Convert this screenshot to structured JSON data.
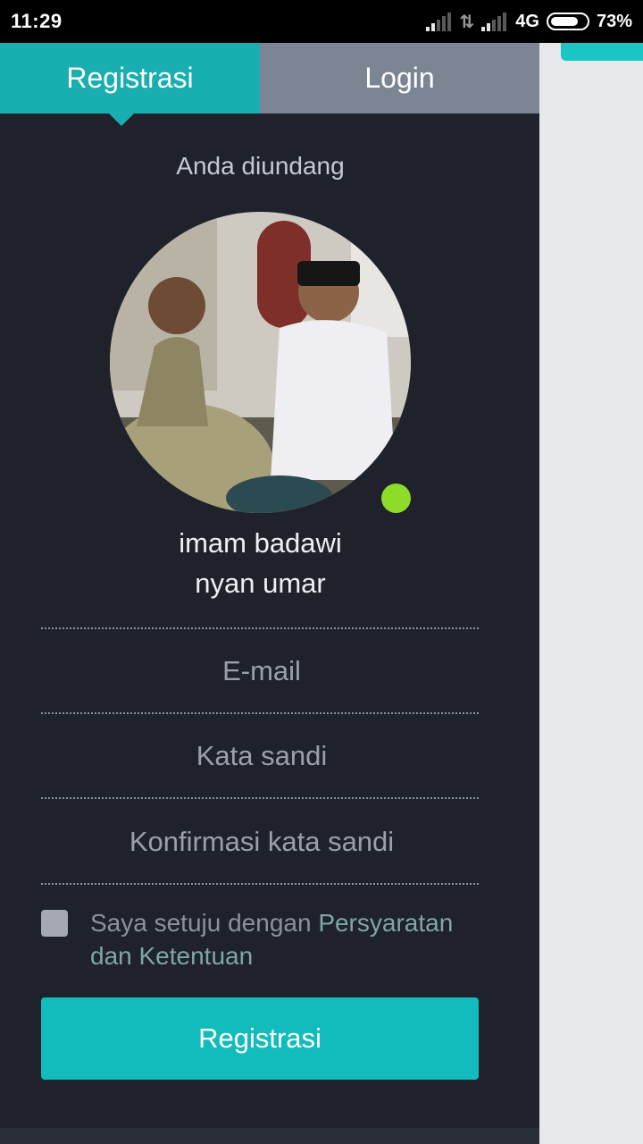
{
  "status_bar": {
    "time": "11:29",
    "network": "4G",
    "battery": "73%",
    "icons": [
      "signal-icon",
      "data-transfer-icon",
      "signal-icon",
      "battery-icon"
    ]
  },
  "tabs": {
    "register": "Registrasi",
    "login": "Login",
    "active": "register"
  },
  "invite": {
    "heading": "Anda diundang",
    "inviter_first": "imam badawi",
    "inviter_last": "nyan umar",
    "online": true
  },
  "form": {
    "email_placeholder": "E-mail",
    "password_placeholder": "Kata sandi",
    "confirm_placeholder": "Konfirmasi kata sandi",
    "terms_prefix": "Saya setuju dengan ",
    "terms_link": "Persyaratan dan Ketentuan",
    "terms_checked": false,
    "submit_label": "Registrasi"
  },
  "colors": {
    "accent": "#19aeb0",
    "button": "#13bcbc",
    "panel": "#1f222a",
    "inactive_tab": "#7c8593",
    "online_dot": "#8ddc2a"
  }
}
